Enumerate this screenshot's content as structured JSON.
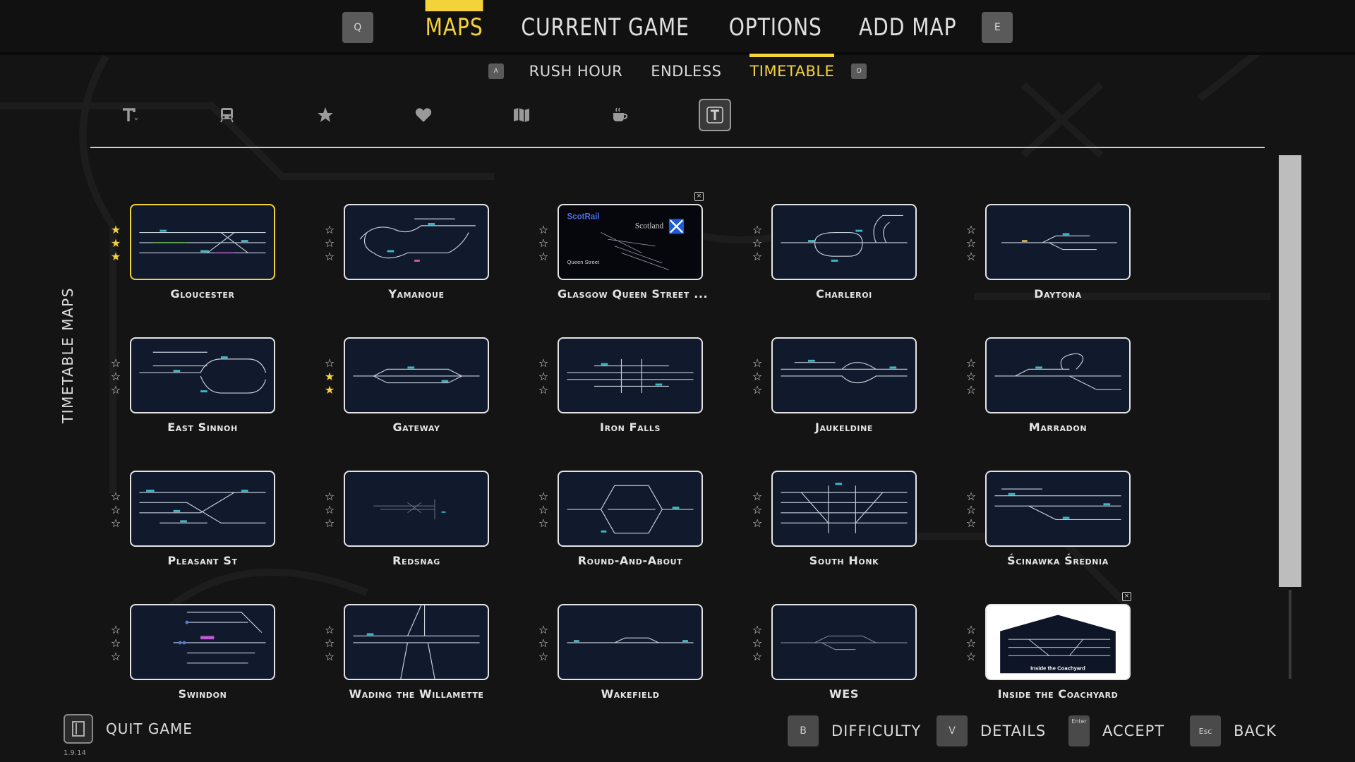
{
  "top_tabs": {
    "prev_key": "Q",
    "next_key": "E",
    "items": [
      {
        "label": "MAPS",
        "active": true
      },
      {
        "label": "CURRENT GAME",
        "active": false
      },
      {
        "label": "OPTIONS",
        "active": false
      },
      {
        "label": "ADD MAP",
        "active": false
      }
    ]
  },
  "sub_tabs": {
    "prev_key": "A",
    "next_key": "D",
    "items": [
      {
        "label": "RUSH HOUR",
        "active": false
      },
      {
        "label": "ENDLESS",
        "active": false
      },
      {
        "label": "TIMETABLE",
        "active": true
      }
    ]
  },
  "filters": [
    {
      "icon": "text-sort-icon",
      "selected": false
    },
    {
      "icon": "train-icon",
      "selected": false
    },
    {
      "icon": "star-icon",
      "selected": false
    },
    {
      "icon": "heart-icon",
      "selected": false
    },
    {
      "icon": "map-icon",
      "selected": false
    },
    {
      "icon": "coffee-icon",
      "selected": false
    },
    {
      "icon": "text-filter-icon",
      "selected": true
    }
  ],
  "side_label": "TIMETABLE MAPS",
  "maps": [
    {
      "name": "Gloucester",
      "stars": 3,
      "selected": true
    },
    {
      "name": "Yamanoue",
      "stars": 0
    },
    {
      "name": "Glasgow Queen Street ...",
      "stars": 0,
      "badge": true
    },
    {
      "name": "Charleroi",
      "stars": 0
    },
    {
      "name": "Daytona",
      "stars": 0
    },
    {
      "name": "East Sinnoh",
      "stars": 0
    },
    {
      "name": "Gateway",
      "stars": 2
    },
    {
      "name": "Iron Falls",
      "stars": 0
    },
    {
      "name": "Jaukeldine",
      "stars": 0
    },
    {
      "name": "Marradon",
      "stars": 0
    },
    {
      "name": "Pleasant St",
      "stars": 0
    },
    {
      "name": "Redsnag",
      "stars": 0
    },
    {
      "name": "Round-And-About",
      "stars": 0
    },
    {
      "name": "South Honk",
      "stars": 0
    },
    {
      "name": "Ścinawka Średnia",
      "stars": 0
    },
    {
      "name": "Swindon",
      "stars": 0
    },
    {
      "name": "Wading the Willamette",
      "stars": 0
    },
    {
      "name": "Wakefield",
      "stars": 0
    },
    {
      "name": "WES",
      "stars": 0
    },
    {
      "name": "Inside the Coachyard",
      "stars": 0,
      "badge": true
    }
  ],
  "thumb_text": {
    "scotrail": "ScotRail",
    "scotland": "Scotland",
    "queen_street": "Queen Street",
    "coachyard": "Inside the Coachyard"
  },
  "bottom": {
    "quit_label": "QUIT GAME",
    "version": "1.9.14",
    "actions": [
      {
        "key": "B",
        "label": "DIFFICULTY"
      },
      {
        "key": "V",
        "label": "DETAILS"
      },
      {
        "key": "Enter",
        "label": "ACCEPT"
      },
      {
        "key": "Esc",
        "label": "BACK"
      }
    ]
  },
  "colors": {
    "accent": "#f4d23a",
    "background": "#141414",
    "thumb_bg": "#111a2c"
  }
}
